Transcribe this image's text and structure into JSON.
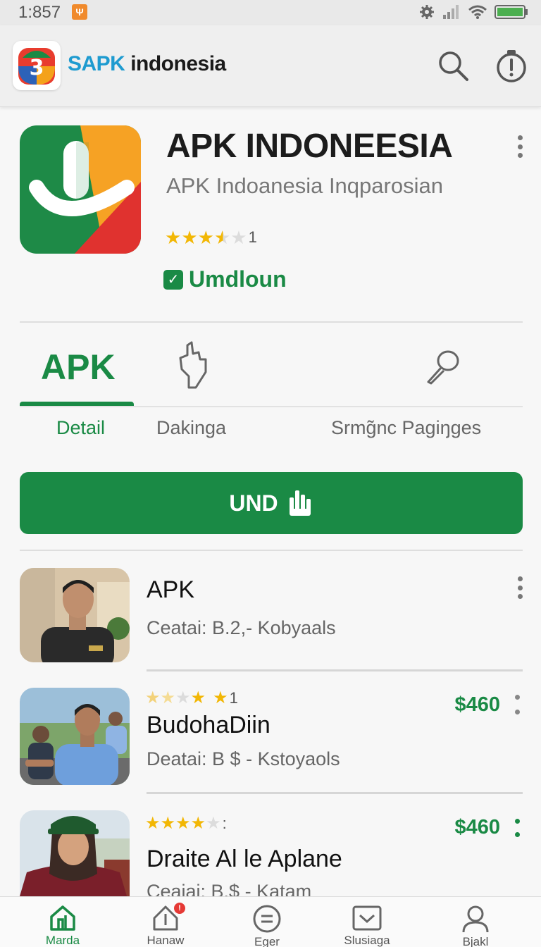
{
  "status_bar": {
    "time": "1:857",
    "notification_glyph": "Ψ"
  },
  "app_bar": {
    "brand_part1": "SAPK",
    "brand_part2": " indonesia"
  },
  "app": {
    "title": "APK INDONEESIA",
    "subtitle": "APK Indoanesia Inqparosian",
    "rating_stars": 3.5,
    "rating_count": "1",
    "installed_label": "Umdloun"
  },
  "tabs": {
    "apk_label": "APK",
    "items": [
      {
        "label": "Detail",
        "active": true
      },
      {
        "label": "Dakinga",
        "active": false
      },
      {
        "label": "Srmg̃nc Pagiŋges",
        "active": false
      }
    ]
  },
  "install_button": {
    "label": "UND"
  },
  "list": [
    {
      "title": "APK",
      "meta": "Ceatai: B.2,- Kobyaals",
      "price": "",
      "stars": null,
      "stars_suffix": ""
    },
    {
      "title": "BudohaDiin",
      "meta": "Deatai: B $ - Kstoyaols",
      "price": "$460",
      "stars": 3.5,
      "stars_suffix": "1"
    },
    {
      "title": "Draite Al le Aplane",
      "meta": "Ceaiai: B.$ - Katam",
      "price": "$460",
      "stars": 4,
      "stars_suffix": ":"
    }
  ],
  "bottom_nav": [
    {
      "label": "Marda",
      "icon": "home-icon",
      "active": true
    },
    {
      "label": "Hanaw",
      "icon": "updates-icon",
      "active": false,
      "badge": "!"
    },
    {
      "label": "Eger",
      "icon": "menu-circle-icon",
      "active": false
    },
    {
      "label": "Slusiaga",
      "icon": "inbox-icon",
      "active": false
    },
    {
      "label": "Bjakl",
      "icon": "profile-icon",
      "active": false
    }
  ],
  "colors": {
    "accent": "#1a8a45",
    "star": "#f2b705",
    "brand_blue": "#1e9bd0"
  }
}
